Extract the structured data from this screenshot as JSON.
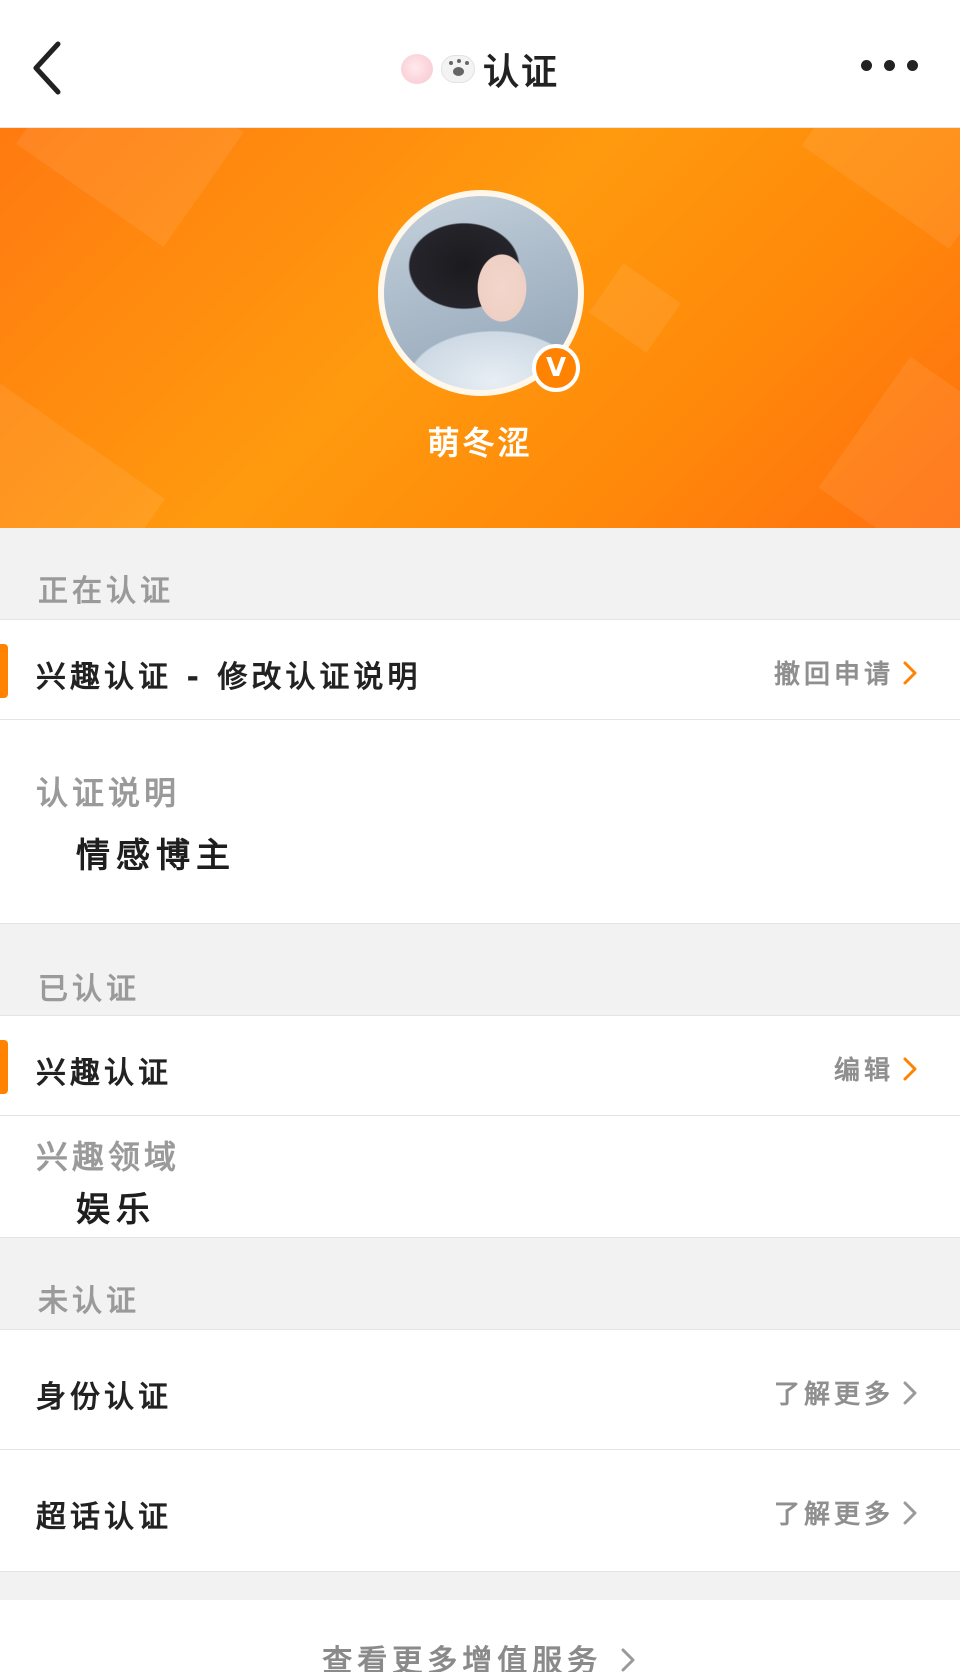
{
  "header": {
    "title": "认证"
  },
  "profile": {
    "name": "萌冬涩",
    "badge": "V"
  },
  "sections": {
    "in_progress": {
      "title": "正在认证",
      "row_label": "兴趣认证 - 修改认证说明",
      "row_action": "撤回申请",
      "detail_key": "认证说明",
      "detail_value": "情感博主"
    },
    "verified": {
      "title": "已认证",
      "row_label": "兴趣认证",
      "row_action": "编辑",
      "detail_key": "兴趣领域",
      "detail_value": "娱乐"
    },
    "unverified": {
      "title": "未认证",
      "items": [
        {
          "label": "身份认证",
          "action": "了解更多"
        },
        {
          "label": "超话认证",
          "action": "了解更多"
        }
      ]
    }
  },
  "footer": {
    "link": "查看更多增值服务"
  },
  "colors": {
    "accent": "#ff8200",
    "banner": "#ff8f0c"
  }
}
